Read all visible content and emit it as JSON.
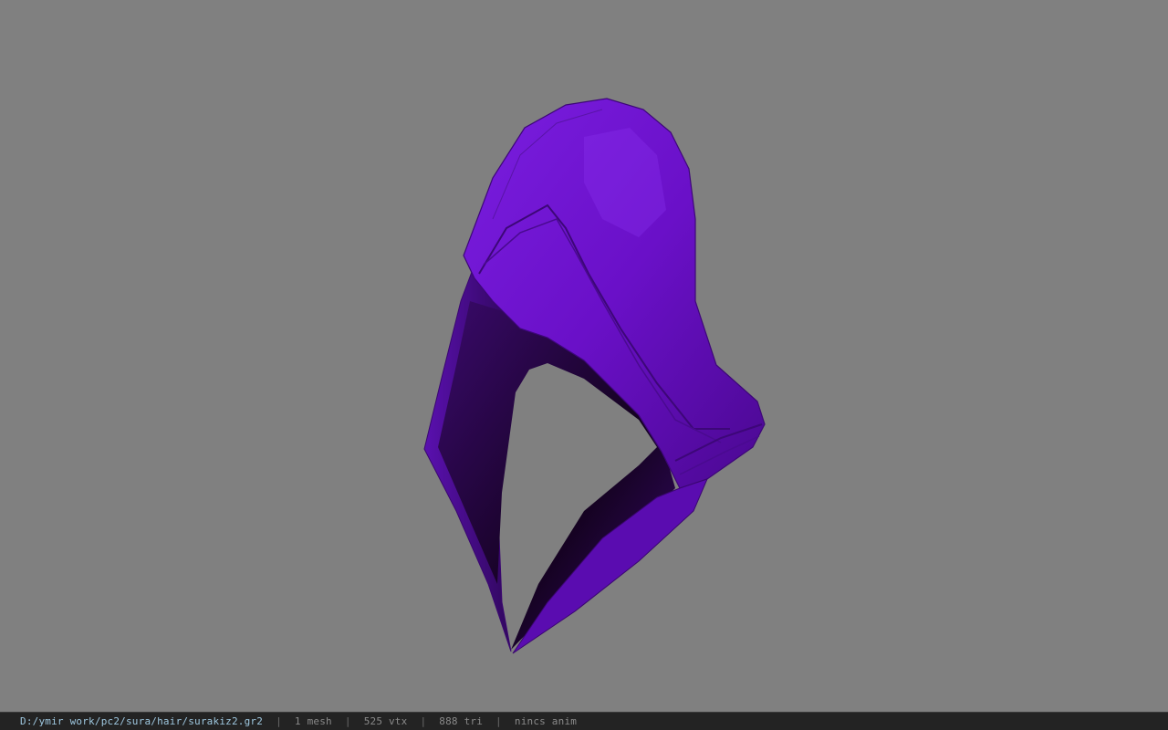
{
  "viewer": {
    "background_color": "#808080",
    "model_color": "#6a12c4",
    "model": "purple hood mesh"
  },
  "status": {
    "file_path": "D:/ymir work/pc2/sura/hair/surakiz2.gr2",
    "separator": "|",
    "mesh_count": "1 mesh",
    "vertex_count": "525 vtx",
    "triangle_count": "888 tri",
    "anim_state": "nincs anim"
  }
}
